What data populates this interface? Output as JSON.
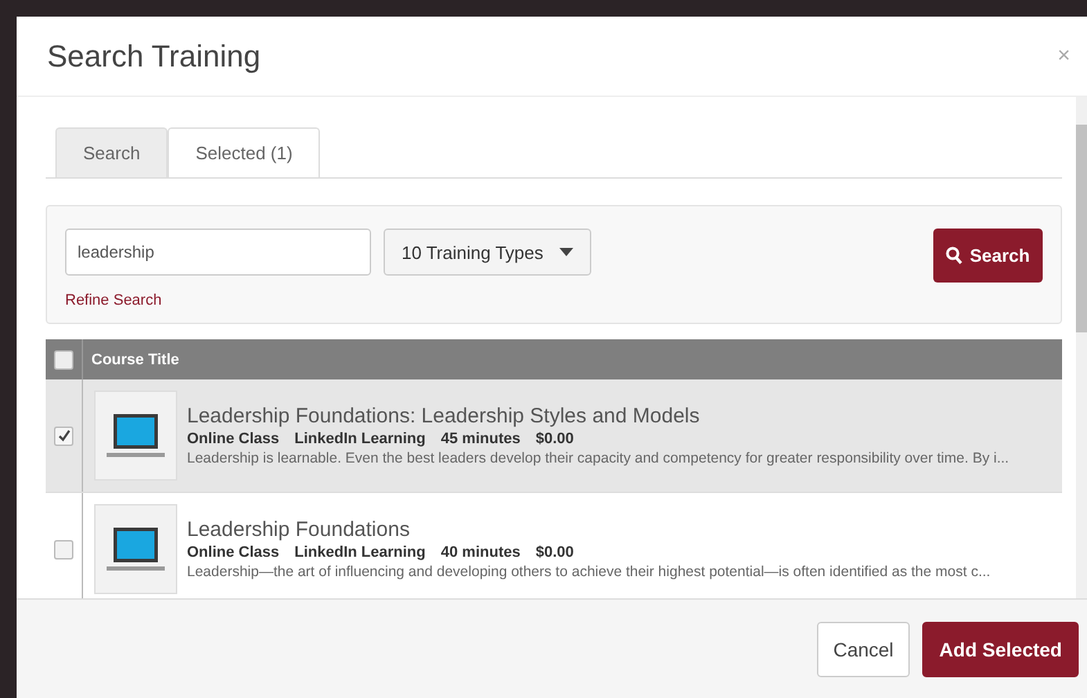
{
  "dialog": {
    "title": "Search Training",
    "close": "×"
  },
  "tabs": [
    {
      "label": "Search",
      "selected": true
    },
    {
      "label": "Selected (1)",
      "selected": false
    }
  ],
  "search": {
    "value": "leadership",
    "training_types": "10 Training Types",
    "button": "Search",
    "refine_link": "Refine Search"
  },
  "table": {
    "select_all_checked": false,
    "columns": [
      "Course Title"
    ],
    "rows": [
      {
        "title": "Leadership Foundations: Leadership Styles and Models",
        "type": "Online Class",
        "provider": "LinkedIn Learning",
        "duration": "45 minutes",
        "price": "$0.00",
        "description": "Leadership is learnable. Even the best leaders develop their capacity and competency for greater responsibility over time. By i...",
        "checked": true
      },
      {
        "title": "Leadership Foundations",
        "type": "Online Class",
        "provider": "LinkedIn Learning",
        "duration": "40 minutes",
        "price": "$0.00",
        "description": "Leadership—the art of influencing and developing others to achieve their highest potential—is often identified as the most c...",
        "checked": false
      }
    ]
  },
  "buttons": [
    "Cancel",
    "Add Selected"
  ]
}
